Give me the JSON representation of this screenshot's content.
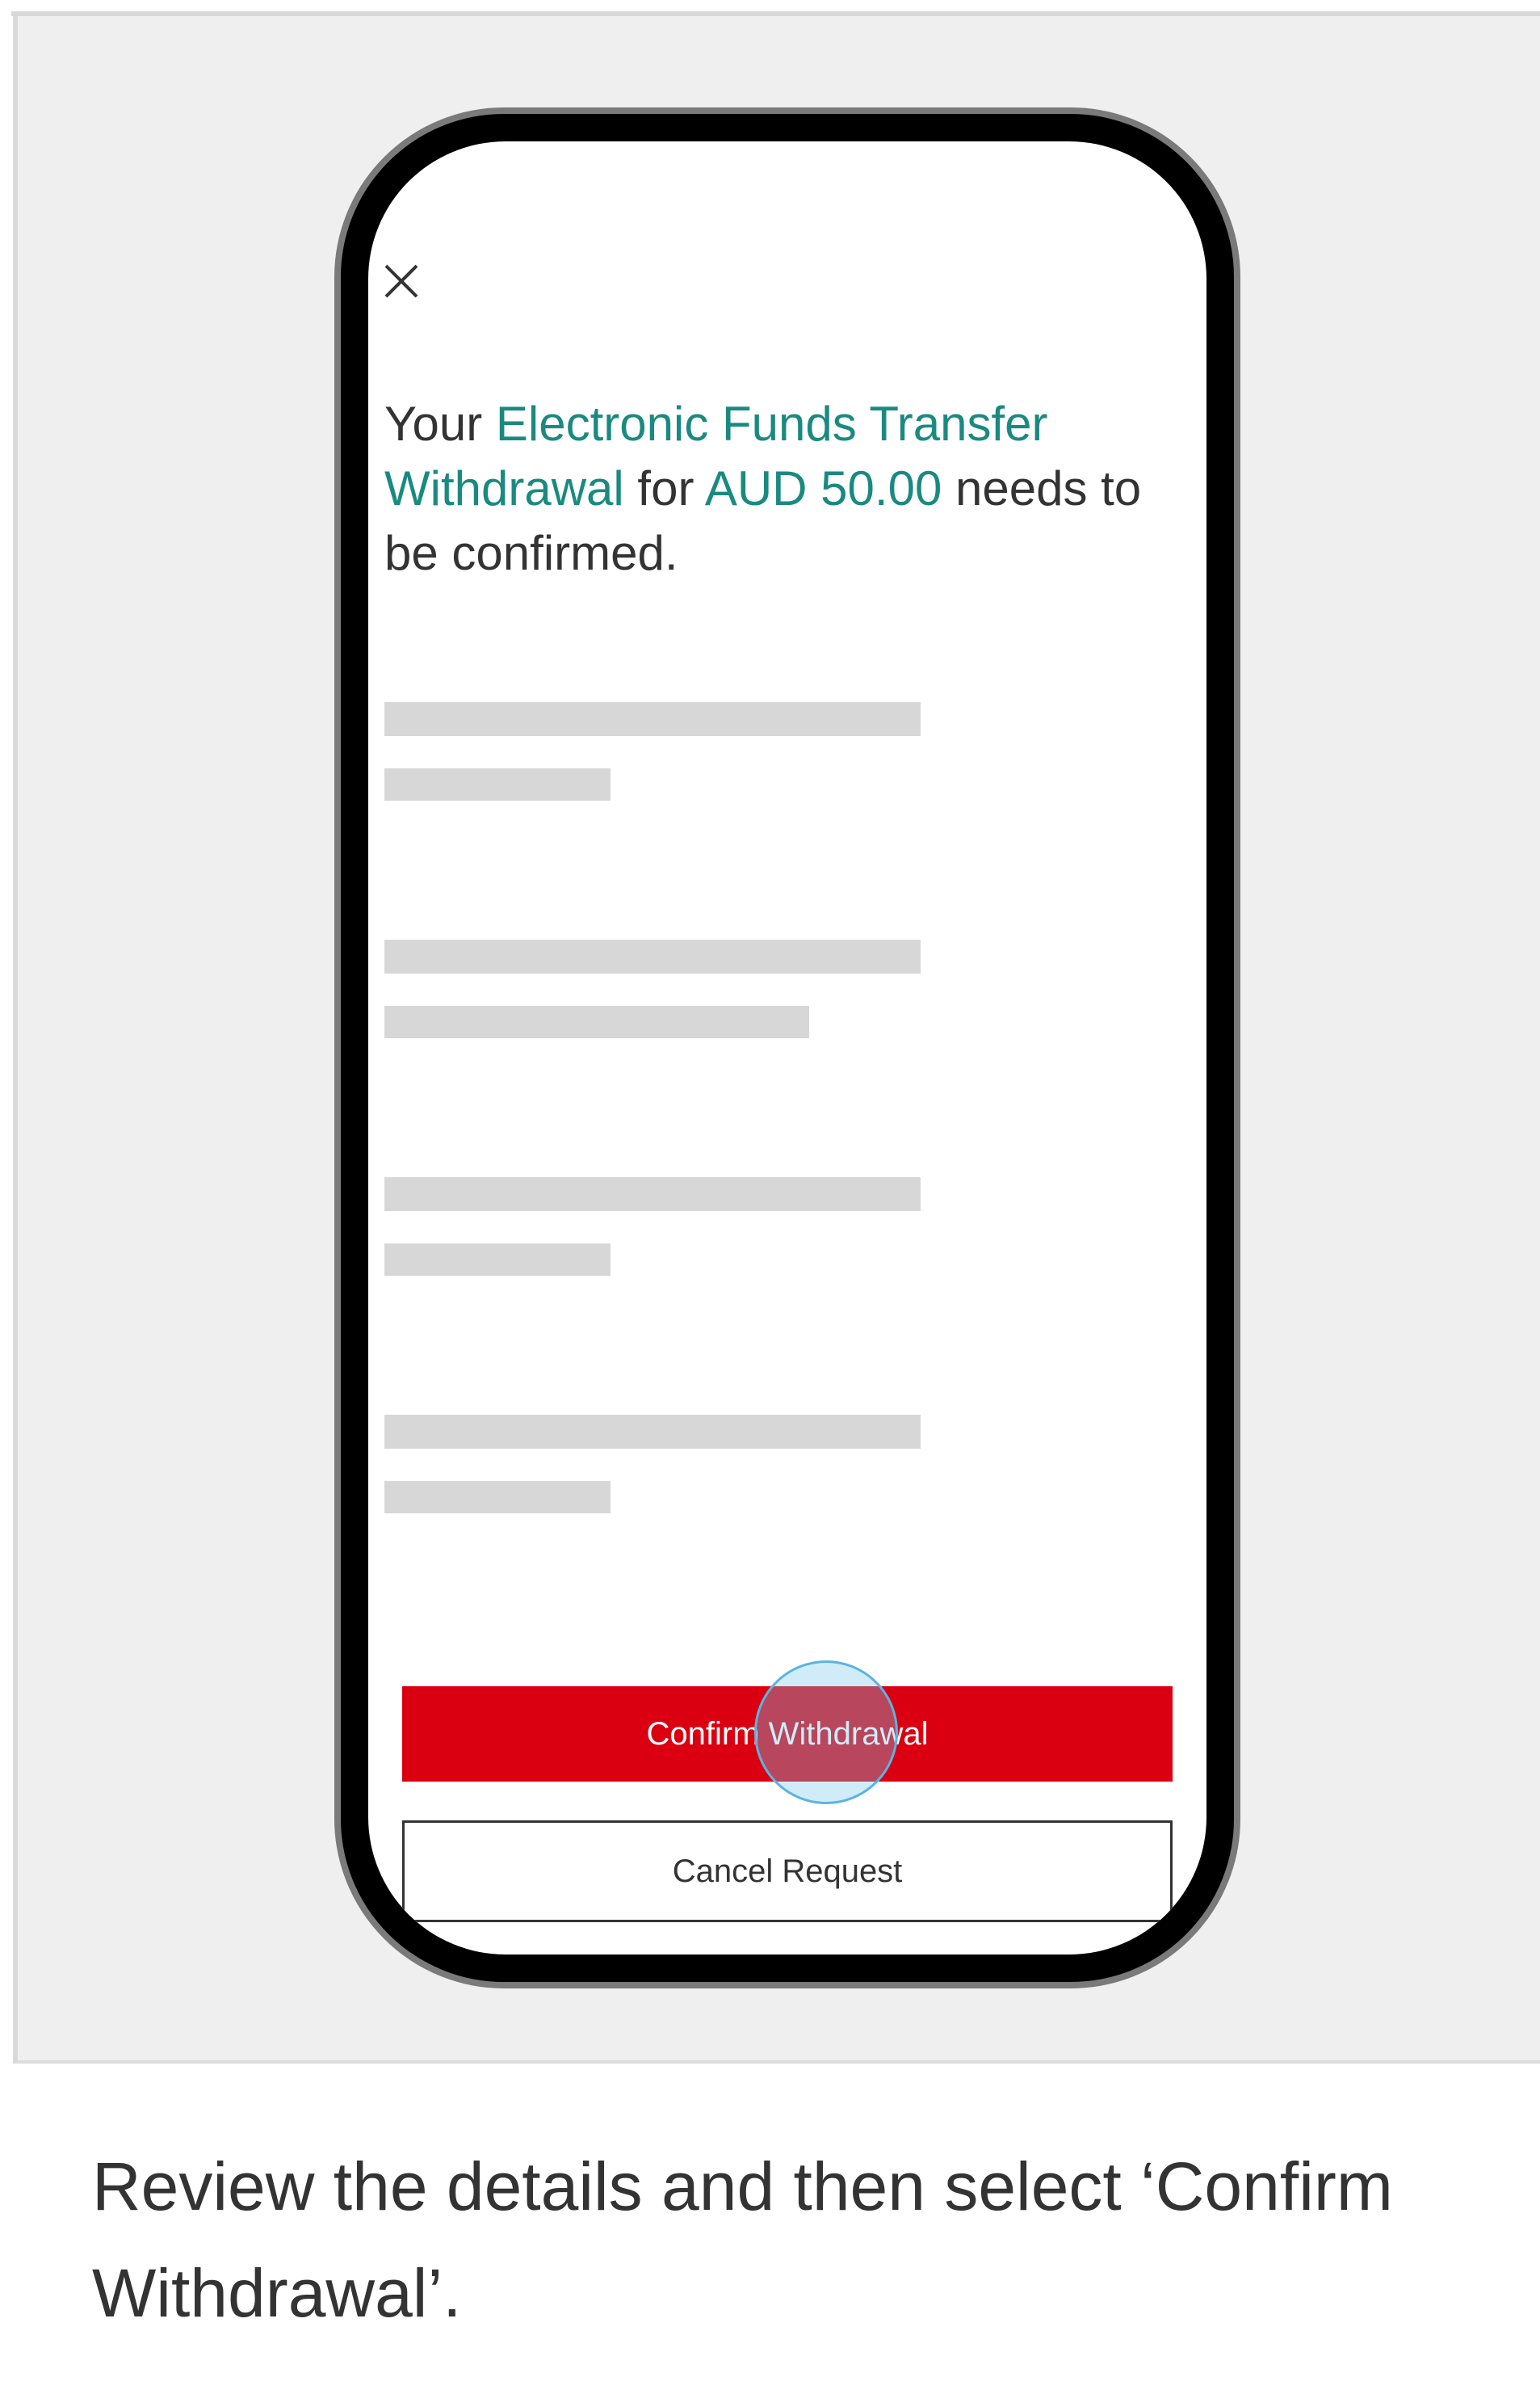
{
  "dialog": {
    "headline": {
      "prefix": "Your",
      "transaction_type": "Electronic Funds Transfer Withdrawal",
      "middle": "for",
      "amount": "AUD 50.00",
      "suffix": "needs to be confirmed."
    },
    "confirm_button_label": "Confirm Withdrawal",
    "cancel_button_label": "Cancel Request"
  },
  "caption": "Review the details and then select ‘Confirm Withdrawal’.",
  "colors": {
    "accent_teal": "#1a8a80",
    "brand_red": "#db0011",
    "skeleton_gray": "#d7d7d7",
    "panel_bg": "#efefef"
  },
  "icons": {
    "close": "close-icon",
    "tap": "tap-indicator"
  }
}
